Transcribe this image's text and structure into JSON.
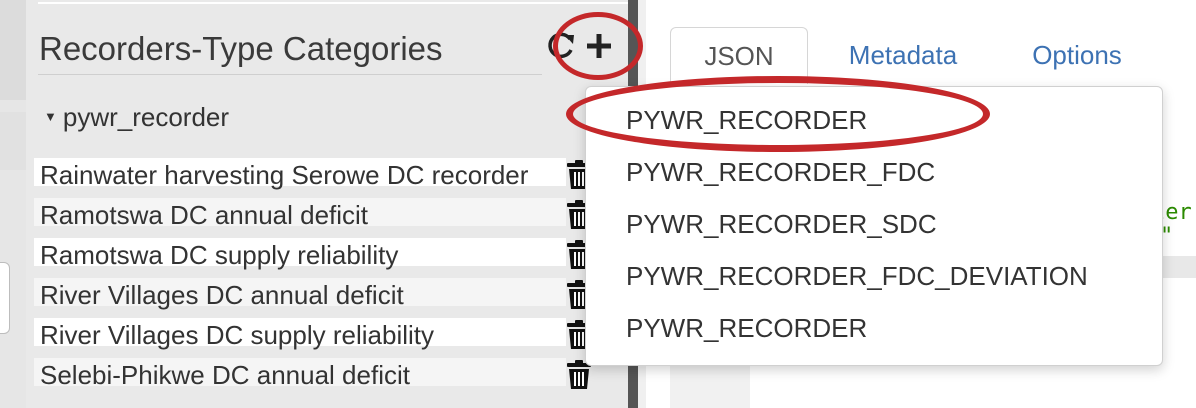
{
  "panel": {
    "title": "Recorders-Type Categories",
    "group": {
      "label": "pywr_recorder",
      "items": [
        "Rainwater harvesting Serowe DC recorder",
        "Ramotswa DC annual deficit",
        "Ramotswa DC supply reliability",
        "River Villages DC annual deficit",
        "River Villages DC supply reliability",
        "Selebi-Phikwe DC annual deficit"
      ]
    },
    "icons": {
      "refresh": "refresh-icon",
      "add": "plus-icon",
      "delete": "trash-icon",
      "caret": "caret-down-icon"
    }
  },
  "tabs": [
    {
      "label": "JSON",
      "active": true
    },
    {
      "label": "Metadata",
      "active": false
    },
    {
      "label": "Options",
      "active": false
    }
  ],
  "editor": {
    "fragment_1": "ler'",
    "fragment_2": "\""
  },
  "dropdown": {
    "items": [
      "PYWR_RECORDER",
      "PYWR_RECORDER_FDC",
      "PYWR_RECORDER_SDC",
      "PYWR_RECORDER_FDC_DEVIATION",
      "PYWR_RECORDER"
    ]
  },
  "colors": {
    "annotation": "#c4282a",
    "link": "#3d72b3",
    "scrollbar": "#555555"
  }
}
